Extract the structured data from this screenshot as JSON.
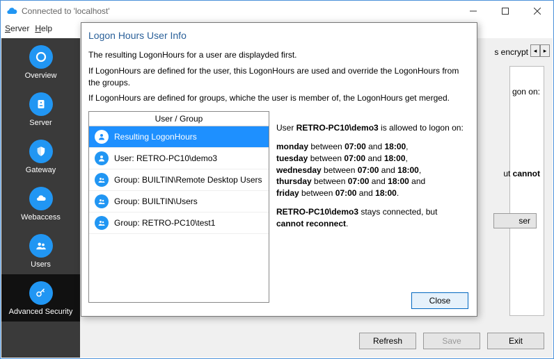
{
  "window": {
    "title": "Connected to 'localhost'"
  },
  "menubar": {
    "server": "Server",
    "help": "Help"
  },
  "win_controls": {
    "min": "Minimize",
    "max": "Maximize",
    "close": "Close"
  },
  "sidebar": {
    "items": [
      {
        "label": "Overview",
        "icon": "overview"
      },
      {
        "label": "Server",
        "icon": "server"
      },
      {
        "label": "Gateway",
        "icon": "shield"
      },
      {
        "label": "Webaccess",
        "icon": "cloud"
      },
      {
        "label": "Users",
        "icon": "users"
      },
      {
        "label": "Advanced Security",
        "icon": "key"
      }
    ]
  },
  "background": {
    "tab_fragment": "s encrypt",
    "right_text1": "gon on:",
    "right_text2a": "ut ",
    "right_text2b": "cannot",
    "btn_fragment": "ser"
  },
  "bottom": {
    "refresh": "Refresh",
    "save": "Save",
    "exit": "Exit"
  },
  "dialog": {
    "title": "Logon Hours User Info",
    "intro1": "The resulting LogonHours for a user are displayded first.",
    "intro2": "If LogonHours are defined for the user, this LogonHours are used and override the LogonHours from the groups.",
    "intro3": "If LogonHours are defined for groups, whiche the user is member of, the LogonHours get merged.",
    "list_header": "User / Group",
    "rows": [
      {
        "label": "Resulting LogonHours",
        "icon": "user",
        "selected": true
      },
      {
        "label": "User: RETRO-PC10\\demo3",
        "icon": "user",
        "selected": false
      },
      {
        "label": "Group: BUILTIN\\Remote Desktop Users",
        "icon": "group",
        "selected": false
      },
      {
        "label": "Group: BUILTIN\\Users",
        "icon": "group",
        "selected": false
      },
      {
        "label": "Group: RETRO-PC10\\test1",
        "icon": "group",
        "selected": false
      }
    ],
    "detail": {
      "line1_pre": "User ",
      "line1_user": "RETRO-PC10\\demo3",
      "line1_post": " is allowed to logon on:",
      "sched": [
        {
          "day": "monday",
          "t1": "07:00",
          "t2": "18:00",
          "tail": ","
        },
        {
          "day": "tuesday",
          "t1": "07:00",
          "t2": "18:00",
          "tail": ","
        },
        {
          "day": "wednesday",
          "t1": "07:00",
          "t2": "18:00",
          "tail": ","
        },
        {
          "day": "thursday",
          "t1": "07:00",
          "t2": "18:00",
          "tail": " and"
        },
        {
          "day": "friday",
          "t1": "07:00",
          "t2": "18:00",
          "tail": "."
        }
      ],
      "between": " between ",
      "and": " and ",
      "foot_user": "RETRO-PC10\\demo3",
      "foot_mid": " stays connected, but ",
      "foot_bold": "cannot reconnect",
      "foot_end": "."
    },
    "close": "Close"
  }
}
